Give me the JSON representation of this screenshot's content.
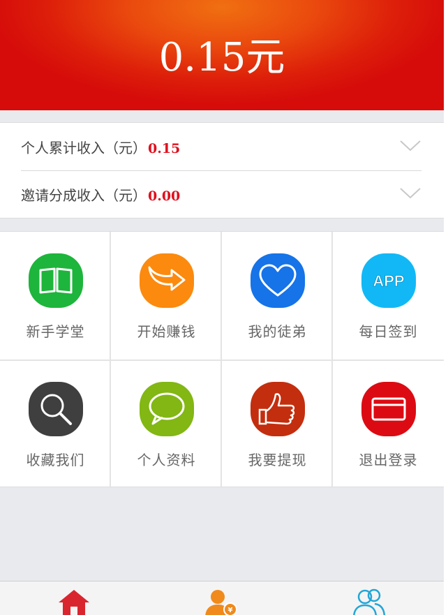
{
  "header": {
    "balance": "0.15元"
  },
  "income": {
    "rows": [
      {
        "label": "个人累计收入（元）",
        "value": "0.15"
      },
      {
        "label": "邀请分成收入（元）",
        "value": "0.00"
      }
    ]
  },
  "menu": {
    "items": [
      {
        "label": "新手学堂",
        "icon": "book-icon",
        "color": "#1db53b"
      },
      {
        "label": "开始赚钱",
        "icon": "share-arrow-icon",
        "color": "#fb8a0f"
      },
      {
        "label": "我的徒弟",
        "icon": "heart-icon",
        "color": "#1673e8"
      },
      {
        "label": "每日签到",
        "icon": "app-icon",
        "color": "#12b8f5"
      },
      {
        "label": "收藏我们",
        "icon": "search-icon",
        "color": "#3f3f3f"
      },
      {
        "label": "个人资料",
        "icon": "chat-bubble-icon",
        "color": "#82b714"
      },
      {
        "label": "我要提现",
        "icon": "thumbs-up-icon",
        "color": "#c32e0e"
      },
      {
        "label": "退出登录",
        "icon": "card-icon",
        "color": "#dc0b13"
      }
    ],
    "app_badge_text": "APP"
  },
  "tabbar": {
    "tabs": [
      {
        "icon": "home-icon",
        "color": "#d9262e"
      },
      {
        "icon": "user-money-icon",
        "color": "#f08a1c"
      },
      {
        "icon": "friends-icon",
        "color": "#22a6d6"
      }
    ],
    "money_symbol": "¥"
  }
}
